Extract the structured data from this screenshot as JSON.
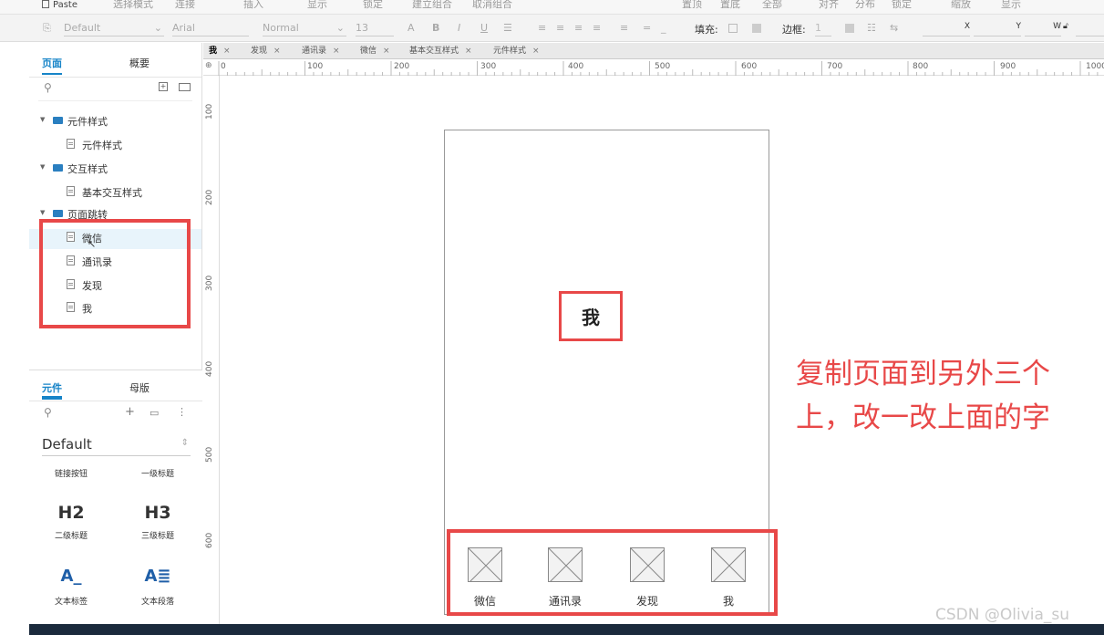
{
  "topbar": {
    "paste_label": "Paste",
    "faint_items": [
      "选择模式",
      "连接",
      "插入",
      "显示",
      "锁定",
      "建立组合",
      "取消组合",
      "置顶",
      "置底",
      "全部",
      "对齐",
      "分布",
      "锁定",
      "缩放",
      "显示"
    ]
  },
  "toolbar": {
    "style": "Default",
    "font": "Arial",
    "weight": "Normal",
    "size": "13",
    "fill_label": "填充:",
    "border_label": "边框:",
    "border_value": "1",
    "x_label": "X",
    "y_label": "Y",
    "w_label": "W"
  },
  "left_panel": {
    "tabs": [
      "页面",
      "概要"
    ],
    "tree": [
      {
        "type": "folder",
        "label": "元件样式"
      },
      {
        "type": "page",
        "label": "元件样式"
      },
      {
        "type": "folder",
        "label": "交互样式"
      },
      {
        "type": "page",
        "label": "基本交互样式"
      },
      {
        "type": "folder",
        "label": "页面跳转"
      },
      {
        "type": "page",
        "label": "微信"
      },
      {
        "type": "page",
        "label": "通讯录"
      },
      {
        "type": "page",
        "label": "发现"
      },
      {
        "type": "page",
        "label": "我"
      }
    ],
    "component_tabs": [
      "元件",
      "母版"
    ],
    "library": "Default",
    "components": [
      {
        "icon": "",
        "label": "链接按钮"
      },
      {
        "icon": "",
        "label": "一级标题"
      },
      {
        "icon": "H2",
        "label": "二级标题"
      },
      {
        "icon": "H3",
        "label": "三级标题"
      },
      {
        "icon": "A_",
        "label": "文本标签"
      },
      {
        "icon": "A≣",
        "label": "文本段落"
      }
    ]
  },
  "doc_tabs": [
    "我",
    "发现",
    "通讯录",
    "微信",
    "基本交互样式",
    "元件样式"
  ],
  "ruler": {
    "h_ticks": [
      "0",
      "100",
      "200",
      "300",
      "400",
      "500",
      "600",
      "700",
      "800",
      "900",
      "1000"
    ],
    "v_ticks": [
      "100",
      "200",
      "300",
      "400",
      "500",
      "600"
    ]
  },
  "canvas": {
    "title": "我",
    "tab_items": [
      "微信",
      "通讯录",
      "发现",
      "我"
    ]
  },
  "annotation": "复制页面到另外三个上，改一改上面的字",
  "watermark": "CSDN @Olivia_su",
  "colors": {
    "highlight": "#e84848",
    "accent": "#1784c8"
  }
}
